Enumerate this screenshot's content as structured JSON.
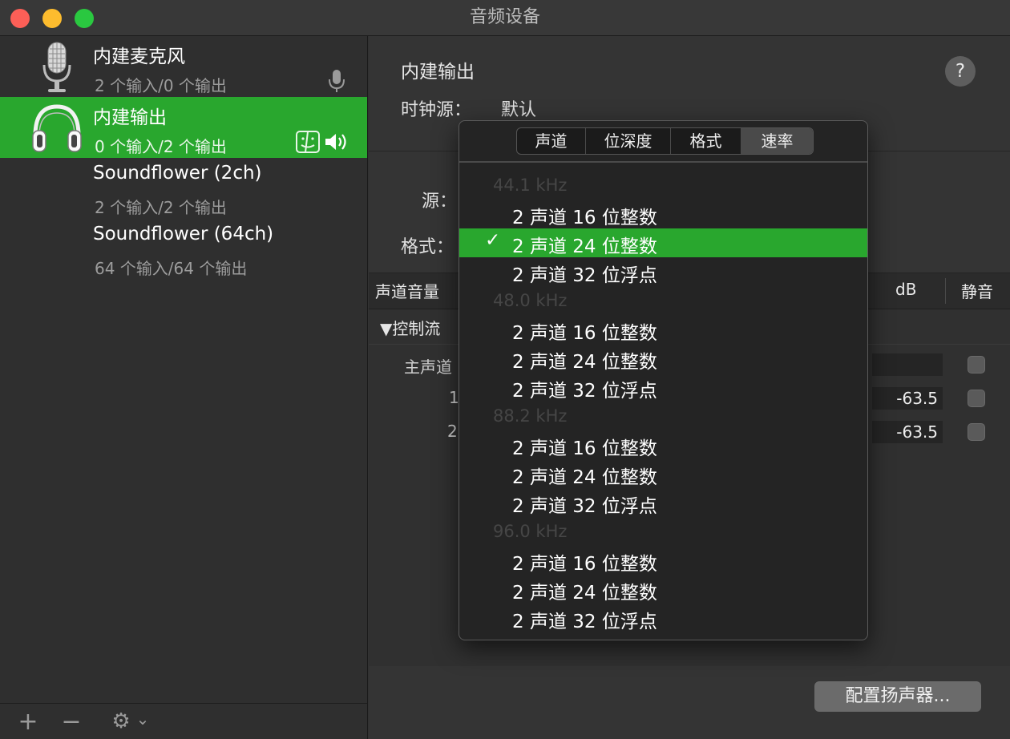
{
  "window": {
    "title": "音频设备"
  },
  "sidebar": {
    "devices": [
      {
        "name": "内建麦克风",
        "io": "2 个输入/0 个输出",
        "selected": false
      },
      {
        "name": "内建输出",
        "io": "0 个输入/2 个输出",
        "selected": true
      },
      {
        "name": "Soundflower (2ch)",
        "io": "2 个输入/2 个输出",
        "selected": false
      },
      {
        "name": "Soundflower (64ch)",
        "io": "64 个输入/64 个输出",
        "selected": false
      }
    ],
    "bottom": {
      "add": "+",
      "remove": "−",
      "gear": "⚙",
      "chevron": "⌄"
    }
  },
  "main": {
    "title": "内建输出",
    "help": "?",
    "clock_label": "时钟源：",
    "clock_value": "默认",
    "source_label": "源：",
    "format_label": "格式：",
    "table": {
      "col_channel_volume": "声道音量",
      "col_db": "dB",
      "col_mute": "静音",
      "group": "▼控制流",
      "rows": [
        {
          "label": "主声道",
          "db": ""
        },
        {
          "label": "1",
          "db": "-63.5"
        },
        {
          "label": "2",
          "db": "-63.5"
        }
      ]
    },
    "configure_button": "配置扬声器..."
  },
  "popup": {
    "tabs": [
      "声道",
      "位深度",
      "格式",
      "速率"
    ],
    "active_tab": "速率",
    "check": "✓",
    "groups": [
      {
        "rate": "44.1 kHz",
        "items": [
          "2 声道 16 位整数",
          "2 声道 24 位整数",
          "2 声道 32 位浮点"
        ]
      },
      {
        "rate": "48.0 kHz",
        "items": [
          "2 声道 16 位整数",
          "2 声道 24 位整数",
          "2 声道 32 位浮点"
        ]
      },
      {
        "rate": "88.2 kHz",
        "items": [
          "2 声道 16 位整数",
          "2 声道 24 位整数",
          "2 声道 32 位浮点"
        ]
      },
      {
        "rate": "96.0 kHz",
        "items": [
          "2 声道 16 位整数",
          "2 声道 24 位整数",
          "2 声道 32 位浮点"
        ]
      }
    ],
    "selected": {
      "group": 0,
      "item": 1
    }
  },
  "colors": {
    "selection": "#29a72e",
    "close": "#fc5f57",
    "minimize": "#fdbc2e",
    "zoom": "#2ac840"
  }
}
